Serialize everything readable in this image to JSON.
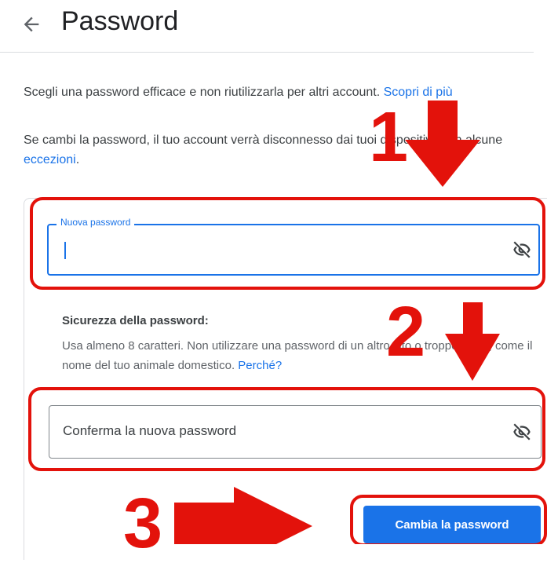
{
  "header": {
    "title": "Password"
  },
  "intro": {
    "text": "Scegli una password efficace e non riutilizzarla per altri account. ",
    "link": "Scopri di più"
  },
  "notice": {
    "text_a": "Se cambi la password, il tuo account verrà disconnesso dai tuoi dispositivi, con alcune ",
    "link": "eccezioni",
    "text_b": "."
  },
  "new_password": {
    "label": "Nuova password",
    "value": ""
  },
  "strength": {
    "title": "Sicurezza della password:",
    "text": "Usa almeno 8 caratteri. Non utilizzare una password di un altro sito o troppo ovvia, come il nome del tuo animale domestico. ",
    "link": "Perché?"
  },
  "confirm_password": {
    "placeholder": "Conferma la nuova password"
  },
  "submit": {
    "label": "Cambia la password"
  },
  "annotations": {
    "step1": "1",
    "step2": "2",
    "step3": "3",
    "color": "#e3120b"
  },
  "icons": {
    "back": "arrow-left-icon",
    "visibility": "eye-off-icon"
  }
}
